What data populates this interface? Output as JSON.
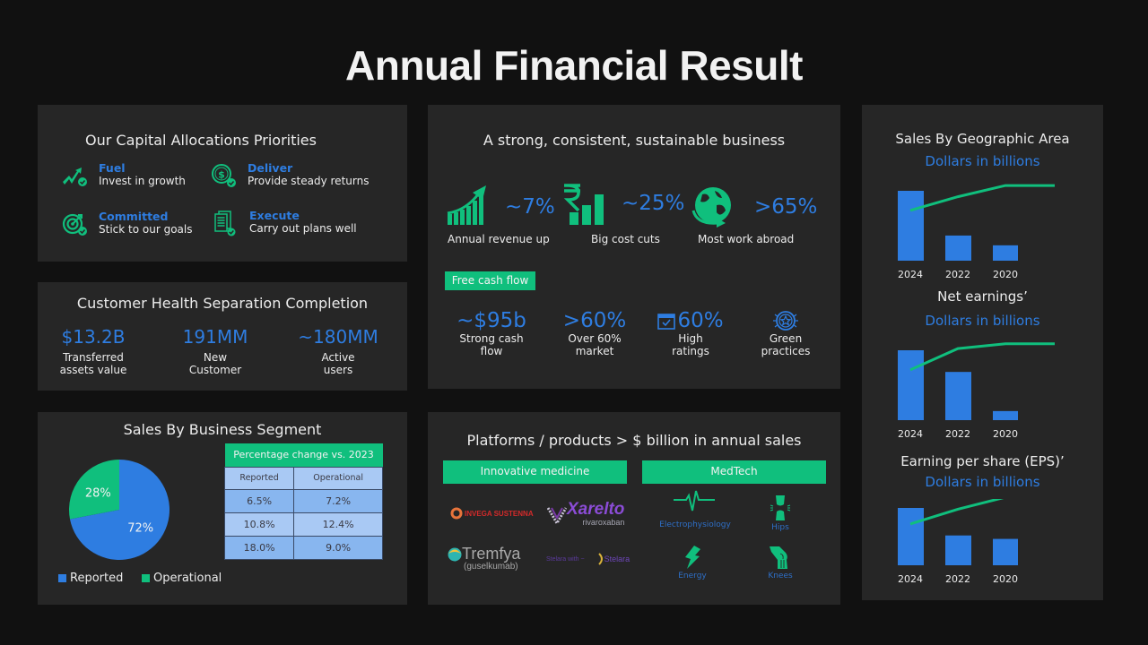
{
  "title": "Annual Financial Result",
  "colors": {
    "accent_blue": "#2e7de1",
    "accent_green": "#10bf7d",
    "panel": "#262626",
    "background": "#111111"
  },
  "capital": {
    "title": "Our Capital Allocations Priorities",
    "items": [
      {
        "icon": "growth-arrow-check-icon",
        "head": "Fuel",
        "sub": "Invest in growth"
      },
      {
        "icon": "dollar-coin-check-icon",
        "head": "Deliver",
        "sub": "Provide steady returns"
      },
      {
        "icon": "target-check-icon",
        "head": "Committed",
        "sub": "Stick to our goals"
      },
      {
        "icon": "document-check-icon",
        "head": "Execute",
        "sub": "Carry out plans well"
      }
    ]
  },
  "customer": {
    "title": "Customer  Health Separation Completion",
    "stats": [
      {
        "value": "$13.2B",
        "label1": "Transferred",
        "label2": "assets  value"
      },
      {
        "value": "191MM",
        "label1": "New",
        "label2": "Customer"
      },
      {
        "value": "~180MM",
        "label1": "Active",
        "label2": "users"
      }
    ]
  },
  "segment": {
    "title": "Sales By Business Segment",
    "table": {
      "header": "Percentage change vs. 2023",
      "columns": [
        "Reported",
        "Operational"
      ],
      "rows": [
        [
          "6.5%",
          "7.2%"
        ],
        [
          "10.8%",
          "12.4%"
        ],
        [
          "18.0%",
          "9.0%"
        ]
      ]
    },
    "legend": [
      "Reported",
      "Operational"
    ]
  },
  "business": {
    "title": "A strong, consistent, sustainable business",
    "kpis": [
      {
        "icon": "growth-chart-icon",
        "value": "~7%",
        "label": "Annual revenue  up"
      },
      {
        "icon": "rupee-bars-icon",
        "value": "~25%",
        "label": "Big cost cuts"
      },
      {
        "icon": "globe-icon",
        "value": ">65%",
        "label": "Most work abroad"
      }
    ],
    "badge": "Free  cash flow",
    "fcf": [
      {
        "value": "~$95b",
        "label1": "Strong cash",
        "label2": "flow"
      },
      {
        "value": ">60%",
        "label1": "Over 60%",
        "label2": "market"
      },
      {
        "value": "60%",
        "icon": "calendar-check-icon",
        "label1": "High",
        "label2": "ratings"
      },
      {
        "value": "",
        "icon": "star-badge-icon",
        "label1": "Green",
        "label2": "practices"
      }
    ]
  },
  "platforms": {
    "title": "Platforms  / products > $ billion in annual sales",
    "categories": [
      "Innovative medicine",
      "MedTech"
    ],
    "logos": [
      {
        "name": "INVEGA SUSTENNA"
      },
      {
        "name": "Xarelto",
        "sub": "rivaroxaban"
      },
      {
        "name": "Tremfya",
        "sub": "(guselkumab)"
      },
      {
        "name": "Stelara"
      }
    ],
    "medtech": [
      {
        "icon": "heartbeat-icon",
        "label": "Electrophysiology"
      },
      {
        "icon": "hip-joint-icon",
        "label": "Hips"
      },
      {
        "icon": "lightning-icon",
        "label": "Energy"
      },
      {
        "icon": "knee-joint-icon",
        "label": "Knees"
      }
    ]
  },
  "chart_data": [
    {
      "type": "pie",
      "title": "Sales By Business Segment",
      "categories": [
        "Reported",
        "Operational"
      ],
      "values": [
        72,
        28
      ],
      "labels": [
        "72%",
        "28%"
      ],
      "colors": [
        "#2e7de1",
        "#10bf7d"
      ],
      "legend": "bottom-left"
    },
    {
      "type": "bar",
      "title": "Sales By Geographic Area",
      "subtitle": "Dollars in billions",
      "categories": [
        "2024",
        "2022",
        "2020"
      ],
      "values": [
        100,
        36,
        22
      ],
      "line": [
        0,
        0.45,
        0.82,
        0.82
      ],
      "ylim": [
        0,
        110
      ]
    },
    {
      "type": "bar",
      "title": "Net earnings’",
      "subtitle": "Dollars in billions",
      "categories": [
        "2024",
        "2022",
        "2020"
      ],
      "values": [
        100,
        69,
        13
      ],
      "line": [
        0,
        0.7,
        0.86,
        0.86
      ],
      "ylim": [
        0,
        110
      ]
    },
    {
      "type": "bar",
      "title": "Earning per share (EPS)’",
      "subtitle": "Dollars in billions",
      "categories": [
        "2024",
        "2022",
        "2020"
      ],
      "values": [
        100,
        52,
        46
      ],
      "line": [
        0,
        0.55,
        1.0,
        1.0
      ],
      "ylim": [
        0,
        110
      ]
    }
  ]
}
